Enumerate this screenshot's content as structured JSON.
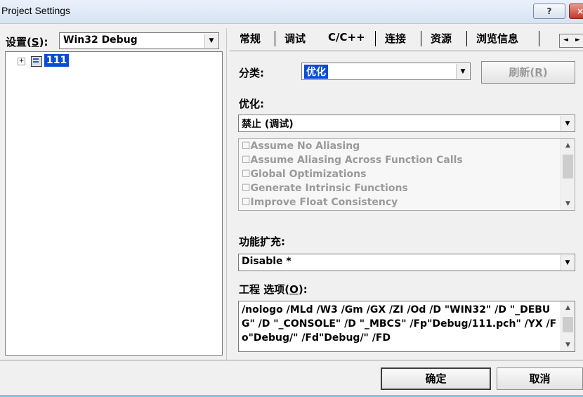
{
  "window": {
    "title": "Project Settings",
    "help_label": "?",
    "close_label": "×"
  },
  "left": {
    "settings_label_prefix": "设置(",
    "settings_label_key": "S",
    "settings_label_suffix": "):",
    "config_value": "Win32 Debug",
    "tree": {
      "expander": "+",
      "node_label": "111"
    }
  },
  "tabs": [
    {
      "label": "常规"
    },
    {
      "label": "调试"
    },
    {
      "label": "C/C++"
    },
    {
      "label": "连接"
    },
    {
      "label": "资源"
    },
    {
      "label": "浏览信息"
    }
  ],
  "tab_scroll": {
    "left": "◄",
    "right": "►"
  },
  "category": {
    "label": "分类:",
    "value": "优化",
    "refresh_prefix": "刷新(",
    "refresh_key": "R",
    "refresh_suffix": ")"
  },
  "optimizations": {
    "label": "优化:",
    "value": "禁止 (调试)",
    "list": [
      "☐Assume No Aliasing",
      "☐Assume Aliasing Across Function Calls",
      "☐Global Optimizations",
      "☐Generate Intrinsic Functions",
      "☐Improve Float Consistency"
    ]
  },
  "extensions": {
    "label": "功能扩充:",
    "value": "Disable *"
  },
  "project_options": {
    "label_prefix": "工程 选项(",
    "label_key": "O",
    "label_suffix": "):",
    "text": "/nologo /MLd /W3 /Gm /GX /ZI /Od /D \"WIN32\" /D \"_DEBUG\" /D \"_CONSOLE\" /D \"_MBCS\" /Fp\"Debug/111.pch\" /YX /Fo\"Debug/\" /Fd\"Debug/\" /FD"
  },
  "buttons": {
    "ok": "确定",
    "cancel": "取消"
  },
  "icons": {
    "dropdown": "▼",
    "scroll_up": "▲",
    "scroll_down": "▼"
  }
}
